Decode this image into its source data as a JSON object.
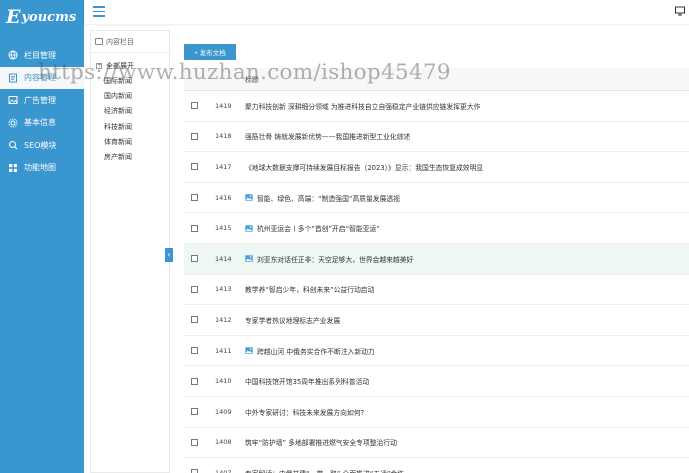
{
  "sidebar": {
    "logo": "youcms",
    "items": [
      {
        "label": "栏目管理",
        "icon": "globe-icon"
      },
      {
        "label": "内容管理",
        "icon": "document-icon",
        "active": true
      },
      {
        "label": "广告管理",
        "icon": "picture-icon"
      },
      {
        "label": "基本信息",
        "icon": "gear-icon"
      },
      {
        "label": "SEO模块",
        "icon": "seo-icon"
      },
      {
        "label": "功能地图",
        "icon": "grid-icon"
      }
    ]
  },
  "tree": {
    "header": "内容栏目",
    "root": "全部展开",
    "items": [
      "国际新闻",
      "国内新闻",
      "经济新闻",
      "科技新闻",
      "体育新闻",
      "房产新闻"
    ]
  },
  "toolbar": {
    "add_label": "+ 发布文档"
  },
  "table": {
    "header_title": "标题",
    "rows": [
      {
        "id": "1419",
        "title": "聚力科技创新 深耕细分领域 为推进科技自立自强稳定产业链供应链发挥更大作",
        "image": false
      },
      {
        "id": "1418",
        "title": "强筋壮骨 铸就发展新优势——我国推进新型工业化综述",
        "image": false
      },
      {
        "id": "1417",
        "title": "《地球大数据支撑可持续发展目标报告（2023）》显示：我国生态恢复成效明显",
        "image": false
      },
      {
        "id": "1416",
        "title": "智能、绿色、高端：“制造强国”高质量发展透视",
        "image": true
      },
      {
        "id": "1415",
        "title": "杭州亚运会丨多个“首创”开启“智能亚运”",
        "image": true
      },
      {
        "id": "1414",
        "title": "刘亚东对话任正非：天空足够大，世界会越来越美好",
        "image": true,
        "highlight": true
      },
      {
        "id": "1413",
        "title": "教学养“智启少年，科创未来”公益行动启动",
        "image": false
      },
      {
        "id": "1412",
        "title": "专家学者热议地理标志产业发展",
        "image": false
      },
      {
        "id": "1411",
        "title": "跨越山河 中俄务实合作不断注入新动力",
        "image": true
      },
      {
        "id": "1410",
        "title": "中国科技馆开馆35周年推出系列科普活动",
        "image": false
      },
      {
        "id": "1409",
        "title": "中外专家研讨：科技未来发展方向如何?",
        "image": false
      },
      {
        "id": "1408",
        "title": "筑牢“防护墙” 多地部署推进燃气安全专项整治行动",
        "image": false
      },
      {
        "id": "1407",
        "title": "专家解读：中俄共建“一带一路” 全面推进“五通”合作",
        "image": false
      }
    ]
  },
  "watermark": "https://www.huzhan.com/ishop45479",
  "colors": {
    "primary": "#3a96cf",
    "sidebar_bg": "#3a96cf",
    "highlight_row": "#eef7f3"
  }
}
